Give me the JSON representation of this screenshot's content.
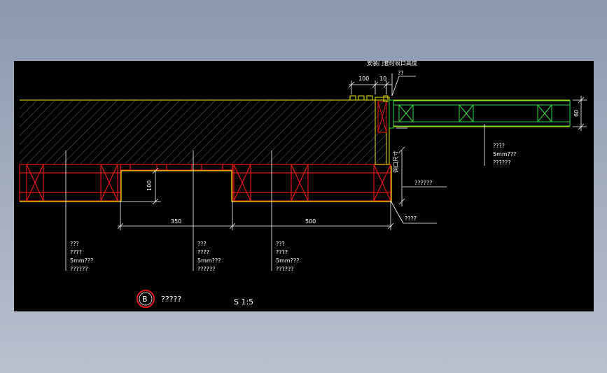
{
  "colors": {
    "background": "#000000",
    "surround": "#9aa5b8",
    "hatch": "#6f6f6f",
    "outline": "#ffffff",
    "finish_yellow": "#e6e600",
    "frame_red": "#e01818",
    "panel_green": "#33cc33"
  },
  "top_note": "安装门套时收口高度",
  "dims": {
    "d100_top": "100",
    "d10_top": "10",
    "d60": "60",
    "d100_side": "100",
    "d350": "350",
    "d500": "500",
    "opening": "洞口尺寸"
  },
  "callouts": {
    "top_q": "??",
    "right_panel": [
      "????",
      "5mm???",
      "??????"
    ],
    "right_mid": "??????",
    "right_low": "????",
    "bottom_1": [
      "???",
      "????",
      "5mm???",
      "??????"
    ],
    "bottom_2": [
      "???",
      "????",
      "5mm???",
      "??????"
    ],
    "bottom_3": [
      "???",
      "????",
      "5mm???",
      "??????"
    ]
  },
  "title_block": {
    "letter": "B",
    "name": "?????",
    "scale": "S 1:5"
  }
}
